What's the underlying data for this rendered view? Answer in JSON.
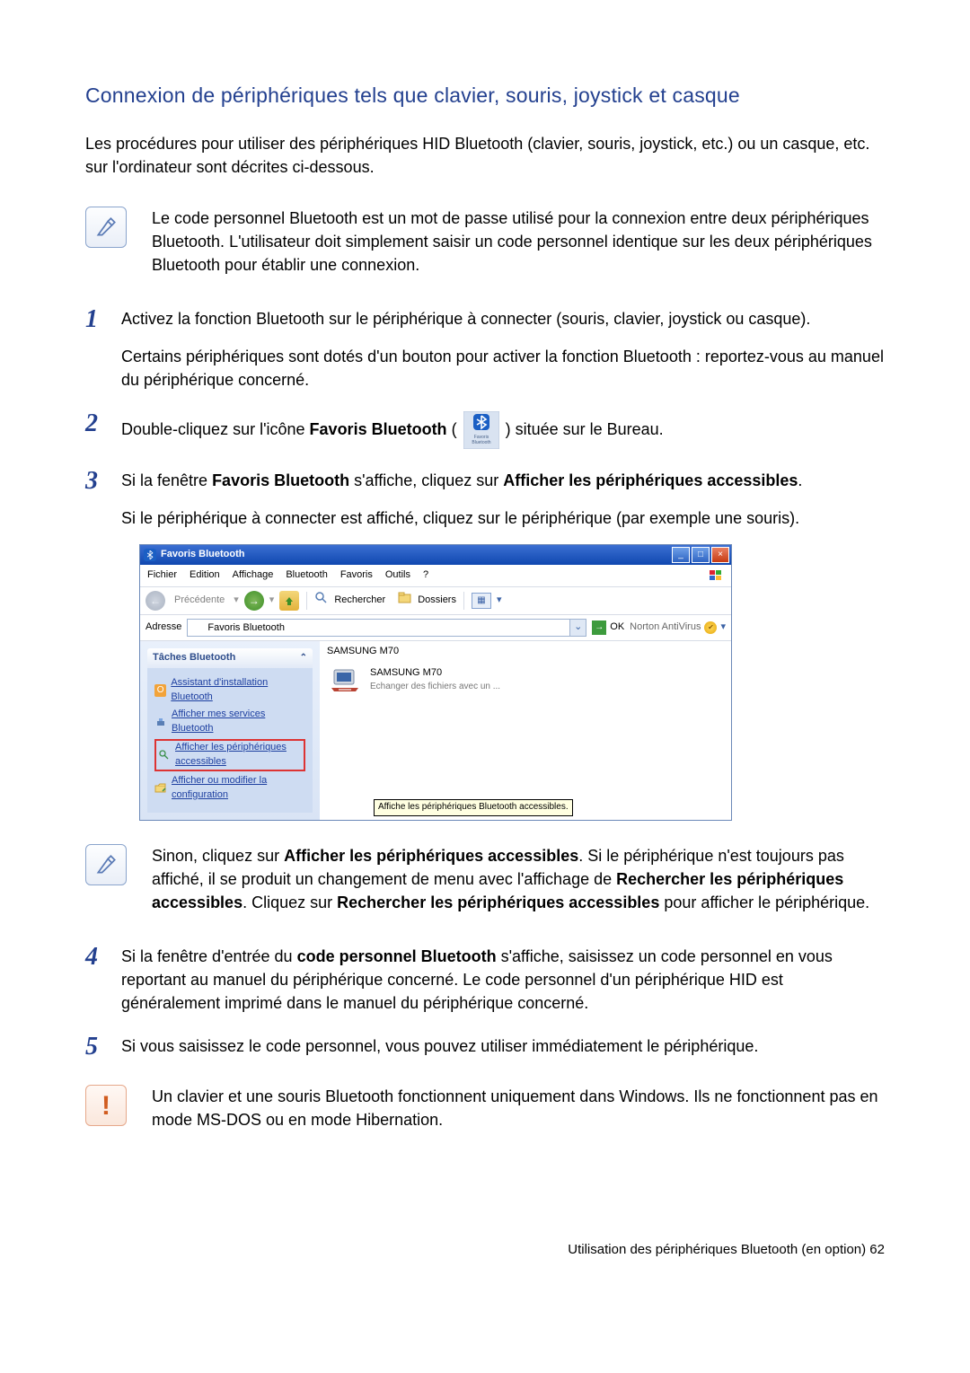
{
  "section_title": "Connexion de périphériques tels que clavier, souris, joystick et casque",
  "intro": "Les procédures pour utiliser des périphériques HID Bluetooth (clavier, souris, joystick, etc.) ou un casque, etc. sur l'ordinateur sont décrites ci-dessous.",
  "note_pin": "Le code personnel Bluetooth est un mot de passe utilisé pour la connexion entre deux périphériques Bluetooth. L'utilisateur doit simplement saisir un code personnel identique sur les deux périphériques Bluetooth pour établir une connexion.",
  "step1_p1": "Activez la fonction Bluetooth sur le périphérique à connecter (souris, clavier, joystick ou casque).",
  "step1_p2": "Certains périphériques sont dotés d'un bouton pour activer la fonction Bluetooth : reportez-vous au manuel du périphérique concerné.",
  "step2_pre": "Double-cliquez sur l'icône ",
  "step2_bold": "Favoris Bluetooth",
  "step2_mid": " (",
  "step2_post": ") située sur le Bureau.",
  "step3_pre": "Si la fenêtre ",
  "step3_b1": "Favoris Bluetooth",
  "step3_mid": " s'affiche, cliquez sur ",
  "step3_b2": "Afficher les périphériques accessibles",
  "step3_post": ".",
  "step3_p2": "Si le périphérique à connecter est affiché, cliquez sur le périphérique (par exemple une souris).",
  "note_view_pre": "Sinon, cliquez sur ",
  "note_view_b1": "Afficher les périphériques accessibles",
  "note_view_mid1": ". Si le périphérique n'est toujours pas affiché, il se produit un changement de menu avec l'affichage de ",
  "note_view_b2": "Rechercher les périphériques accessibles",
  "note_view_mid2": ". Cliquez sur ",
  "note_view_b3": "Rechercher les périphériques accessibles",
  "note_view_post": " pour afficher le périphérique.",
  "step4_pre": "Si la fenêtre d'entrée du ",
  "step4_b": "code personnel Bluetooth",
  "step4_post": " s'affiche, saisissez un code personnel en vous reportant au manuel du périphérique concerné. Le code personnel d'un périphérique HID est généralement imprimé dans le manuel du périphérique concerné.",
  "step5": "Si vous saisissez le code personnel, vous pouvez utiliser immédiatement le périphérique.",
  "warn": "Un clavier et une souris Bluetooth fonctionnent uniquement dans Windows. Ils ne fonctionnent pas en mode MS-DOS ou en mode Hibernation.",
  "footer": "Utilisation des périphériques Bluetooth (en option)   62",
  "desktop_icon_caption": "Favoris Bluetooth",
  "win": {
    "title": "Favoris Bluetooth",
    "menu": {
      "fichier": "Fichier",
      "edition": "Edition",
      "affichage": "Affichage",
      "bluetooth": "Bluetooth",
      "favoris": "Favoris",
      "outils": "Outils",
      "aide": "?"
    },
    "tb": {
      "precedente": "Précédente",
      "rechercher": "Rechercher",
      "dossiers": "Dossiers"
    },
    "addr_label": "Adresse",
    "addr_value": "Favoris Bluetooth",
    "ok": "OK",
    "norton": "Norton AntiVirus",
    "side": {
      "header": "Tâches Bluetooth",
      "items": {
        "assistant": "Assistant d'installation Bluetooth",
        "services": "Afficher mes services Bluetooth",
        "peripheriques_l1": "Afficher les périphériques",
        "peripheriques_l2": "accessibles",
        "config": "Afficher ou modifier la configuration"
      }
    },
    "group": "SAMSUNG M70",
    "device_name": "SAMSUNG M70",
    "device_desc": "Echanger des fichiers avec un ...",
    "tooltip": "Affiche les périphériques Bluetooth accessibles."
  }
}
